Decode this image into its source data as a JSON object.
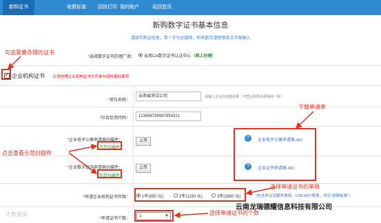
{
  "nav": {
    "tabs": [
      {
        "label": "新购证书"
      },
      {
        "label": "收费标准"
      },
      {
        "label": "回执打印"
      },
      {
        "label": "我的账户"
      },
      {
        "label": "返回首页"
      }
    ]
  },
  "page": {
    "title": "新购数字证书基本信息",
    "subtitle": "请填写购证信息，带 * 号为必填项，所有数字请使用英文半角输入"
  },
  "ca": {
    "label": "选择数字证书办理厂商：",
    "option": "云南CA数字证书认证中心（",
    "online": "网上办理",
    "close": "）"
  },
  "enterprise": {
    "label": "企业机构证书",
    "note": "必须办理企业机构证书方可参与招标投标事项"
  },
  "fields": {
    "unit_name": {
      "label": "单位名称：",
      "value": "云南省测试公司",
      "hint": "请输入企业的完整名称（与营业执照名称保持一致）"
    },
    "credit_code": {
      "label": "社会信用代码：",
      "value": "123456789987654321"
    },
    "seal_plugin": {
      "label": "企业电子公章申请表扫描件：",
      "upload": "上传",
      "sample": "示范扫描件",
      "doc": "企业电子公章申请表.doc"
    },
    "cert_plugin": {
      "label": "企业数字证书申请表扫描件：",
      "upload": "上传",
      "sample": "示范扫描件",
      "doc": "企业证书申请表.doc"
    },
    "years": {
      "label": "申请企业机构证书年限：",
      "options": [
        "1年(650 元)",
        "2年(1150 元)",
        "3年(1650 元)"
      ],
      "selected": 0,
      "note": "（包含年认证服务费用、USB-KEY费用，详见“收费标准”）"
    },
    "count": {
      "label": "申请证书个数：",
      "value": "1"
    }
  },
  "annotations": {
    "choose_cert": "勾选需要办理的证书",
    "download_form": "下载申请表",
    "view_sample": "点击查看示范扫描件",
    "choose_years": "选择申请证书的年限",
    "choose_count": "选择申请证书的个数"
  },
  "watermarks": {
    "left": "大数据说",
    "right": "云南龙瑞德耀信息科技有限公司"
  }
}
